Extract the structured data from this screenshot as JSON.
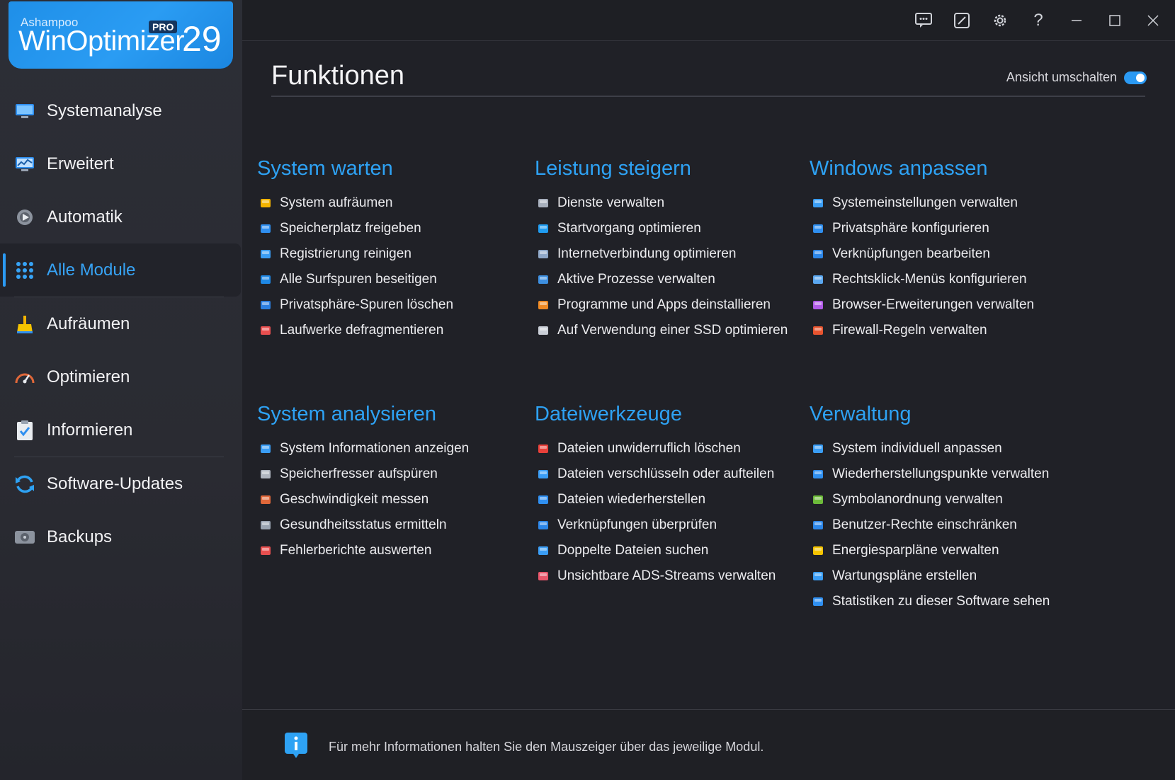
{
  "logo": {
    "brand": "Ashampoo",
    "product": "WinOptimizer",
    "badge": "PRO",
    "version": "29"
  },
  "sidebar": {
    "items": [
      {
        "label": "Systemanalyse",
        "icon": "monitor-icon"
      },
      {
        "label": "Erweitert",
        "icon": "chart-monitor-icon"
      },
      {
        "label": "Automatik",
        "icon": "gear-play-icon"
      },
      {
        "label": "Alle Module",
        "icon": "grid-icon",
        "active": true
      },
      {
        "label": "Aufräumen",
        "icon": "broom-icon"
      },
      {
        "label": "Optimieren",
        "icon": "speedometer-icon"
      },
      {
        "label": "Informieren",
        "icon": "clipboard-check-icon"
      },
      {
        "label": "Software-Updates",
        "icon": "refresh-icon"
      },
      {
        "label": "Backups",
        "icon": "drive-icon"
      }
    ]
  },
  "titlebar": {
    "buttons": [
      "feedback-icon",
      "edit-icon",
      "settings-icon",
      "help-icon",
      "minimize-icon",
      "maximize-icon",
      "close-icon"
    ]
  },
  "main": {
    "title": "Funktionen",
    "toggle_label": "Ansicht umschalten",
    "sections": [
      {
        "title": "System warten",
        "items": [
          {
            "label": "System aufräumen",
            "color": "#f5b400"
          },
          {
            "label": "Speicherplatz freigeben",
            "color": "#2f8ff0"
          },
          {
            "label": "Registrierung reinigen",
            "color": "#3a9df5"
          },
          {
            "label": "Alle Surfspuren beseitigen",
            "color": "#1e88e5"
          },
          {
            "label": "Privatsphäre-Spuren löschen",
            "color": "#2c7fe0"
          },
          {
            "label": "Laufwerke defragmentieren",
            "color": "#e84f4f"
          }
        ]
      },
      {
        "title": "Leistung steigern",
        "items": [
          {
            "label": "Dienste verwalten",
            "color": "#a8b0bd"
          },
          {
            "label": "Startvorgang optimieren",
            "color": "#1f9cf0"
          },
          {
            "label": "Internetverbindung optimieren",
            "color": "#8fa8c8"
          },
          {
            "label": "Aktive Prozesse verwalten",
            "color": "#3d8fe0"
          },
          {
            "label": "Programme und Apps deinstallieren",
            "color": "#f08a24"
          },
          {
            "label": "Auf Verwendung einer SSD optimieren",
            "color": "#c9ced6"
          }
        ]
      },
      {
        "title": "Windows anpassen",
        "items": [
          {
            "label": "Systemeinstellungen verwalten",
            "color": "#3a9df5"
          },
          {
            "label": "Privatsphäre konfigurieren",
            "color": "#2f8ff0"
          },
          {
            "label": "Verknüpfungen bearbeiten",
            "color": "#2c86e8"
          },
          {
            "label": "Rechtsklick-Menüs konfigurieren",
            "color": "#5aa7f0"
          },
          {
            "label": "Browser-Erweiterungen verwalten",
            "color": "#b15be8"
          },
          {
            "label": "Firewall-Regeln verwalten",
            "color": "#e8542f"
          }
        ]
      },
      {
        "title": "System analysieren",
        "items": [
          {
            "label": "System Informationen anzeigen",
            "color": "#3a9df5"
          },
          {
            "label": "Speicherfresser aufspüren",
            "color": "#b0b6c0"
          },
          {
            "label": "Geschwindigkeit messen",
            "color": "#e0683a"
          },
          {
            "label": "Gesundheitsstatus ermitteln",
            "color": "#9aa4b2"
          },
          {
            "label": "Fehlerberichte auswerten",
            "color": "#e84f4f"
          }
        ]
      },
      {
        "title": "Dateiwerkzeuge",
        "items": [
          {
            "label": "Dateien unwiderruflich löschen",
            "color": "#e8403a"
          },
          {
            "label": "Dateien verschlüsseln oder aufteilen",
            "color": "#3a9df5"
          },
          {
            "label": "Dateien wiederherstellen",
            "color": "#2f8ff0"
          },
          {
            "label": "Verknüpfungen überprüfen",
            "color": "#2c86e8"
          },
          {
            "label": "Doppelte Dateien suchen",
            "color": "#3a9df5"
          },
          {
            "label": "Unsichtbare ADS-Streams verwalten",
            "color": "#e8556a"
          }
        ]
      },
      {
        "title": "Verwaltung",
        "items": [
          {
            "label": "System individuell anpassen",
            "color": "#3a9df5"
          },
          {
            "label": "Wiederherstellungspunkte verwalten",
            "color": "#2f8ff0"
          },
          {
            "label": "Symbolanordnung verwalten",
            "color": "#6dbb3a"
          },
          {
            "label": "Benutzer-Rechte einschränken",
            "color": "#2c86e8"
          },
          {
            "label": "Energiesparpläne verwalten",
            "color": "#f5c400"
          },
          {
            "label": "Wartungspläne erstellen",
            "color": "#3a9df5"
          },
          {
            "label": "Statistiken zu dieser Software sehen",
            "color": "#2f8ff0"
          }
        ]
      }
    ]
  },
  "footer": {
    "info": "Für mehr Informationen halten Sie den Mauszeiger über das jeweilige Modul."
  },
  "colors": {
    "accent": "#2ea2f4",
    "background": "#202127",
    "sidebar": "#2b2c33"
  }
}
